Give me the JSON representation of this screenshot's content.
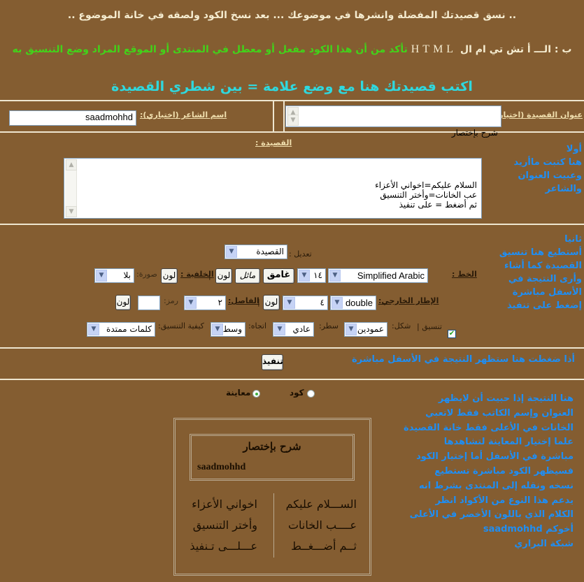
{
  "header": {
    "line1": ".. نسق قصيدتك المفضلة وانشرها في موضوعك ... بعد نسخ الكود ولصقه في خانة الموضوع ..",
    "line2_prefix": "ب : الـــ أ تش تي ام ال",
    "line2_html": "HTML",
    "line2_suffix": "تأكد من أن هذا الكود مفعل أو معطل في المنتدى أو الموقع المراد وضع التنسيق به",
    "line3": "اكتب قصيدتك هنا مع وضع علامة  =  بين شطري القصيدة"
  },
  "form": {
    "title_label": "عنوان القصيدة (اختياري):",
    "title_value": "شرح بإختصار",
    "poet_label": "اسم الشاعر (اختياري):",
    "poet_value": "saadmohhd",
    "poem_label": "القصيدة :",
    "poem_value": "السلام عليكم=اخواني الأعزاء\nعب الخانات=وأختر التنسيق\nثم أضغط = على تنفيذ",
    "edit_label": "تعديل :",
    "edit_select": "القصيدة",
    "font_label": "الخط :",
    "font_select": "Simplified Arabic",
    "size_select": "١٤",
    "bold_button": "غامق",
    "italic_button": "مائل",
    "color_button": "لون",
    "bg_label": "الخلفية :",
    "image_label": "صورة:",
    "image_select": "بلا",
    "border_label": "الإطار الخارجي:",
    "border_style_select": "double",
    "border_width_select": "٤",
    "separator_label": "الفاصل:",
    "separator_select": "٢",
    "symbol_label": "رمز:",
    "symbol_value": "",
    "align_checkbox_label": "تنسيق |",
    "align_checked": true,
    "shape_label": "شكل:",
    "shape_select": "عمودين",
    "line_label": "سطر:",
    "line_select": "عادي",
    "direction_label": "اتجاه:",
    "direction_select": "وسط",
    "method_label": "كيفية التنسيق:",
    "method_select": "كلمات ممتدة",
    "execute_button": "تنفيذ"
  },
  "hints": {
    "first": [
      "أولا",
      "هنا كتبت ماأريد",
      "وعبيت العنوان",
      "والشاعر"
    ],
    "second": [
      "ثانيا",
      "أستطيع هنا تنسيق",
      "القصيدة كما أشاء",
      "وأرى النتيجة في",
      "الأسفل مباشرة",
      "إضغط على تنفيذ"
    ],
    "execute_hint": "أذا ضغطت هنا ستظهر النتيجة في الأسفل مباشرة",
    "result": [
      "هنا النتيجة  إذا حبيت أن لايظهر",
      "العنوان وإسم الكاتب فقط لاتعبي",
      "الخانات في الأعلى فقط خانة القصيدة",
      "علما إختيار المعاينة لتشاهدها",
      "مباشرة في الأسفل أما إختيار الكود",
      "فسيظهر الكود مباشرة تستطيع",
      "نسخه ونقله إلى المنتدى بشرط انه",
      "يدعم هذا النوع من الأكواد انظر",
      "الكلام الذي باللون الأخضر في الأعلى",
      "أخوكم saadmohhd",
      "شبكة البراري"
    ]
  },
  "view": {
    "code_label": "كود",
    "preview_label": "معاينة",
    "selected": "preview"
  },
  "preview": {
    "title": "شرح بإختصار",
    "poet": "saadmohhd",
    "right_column": [
      "الســـلام عليكم",
      "عــــب الخانات",
      "ثــم أضـــغــط"
    ],
    "left_column": [
      "اخواني الأعزاء",
      "وأختر التنسيق",
      "عـــلـــى تـنفيذ"
    ]
  },
  "colors": {
    "background": "#845d31",
    "hint_blue": "#1f8ef3",
    "green_note": "#42d21a",
    "cyan_heading": "#2fd8de"
  }
}
